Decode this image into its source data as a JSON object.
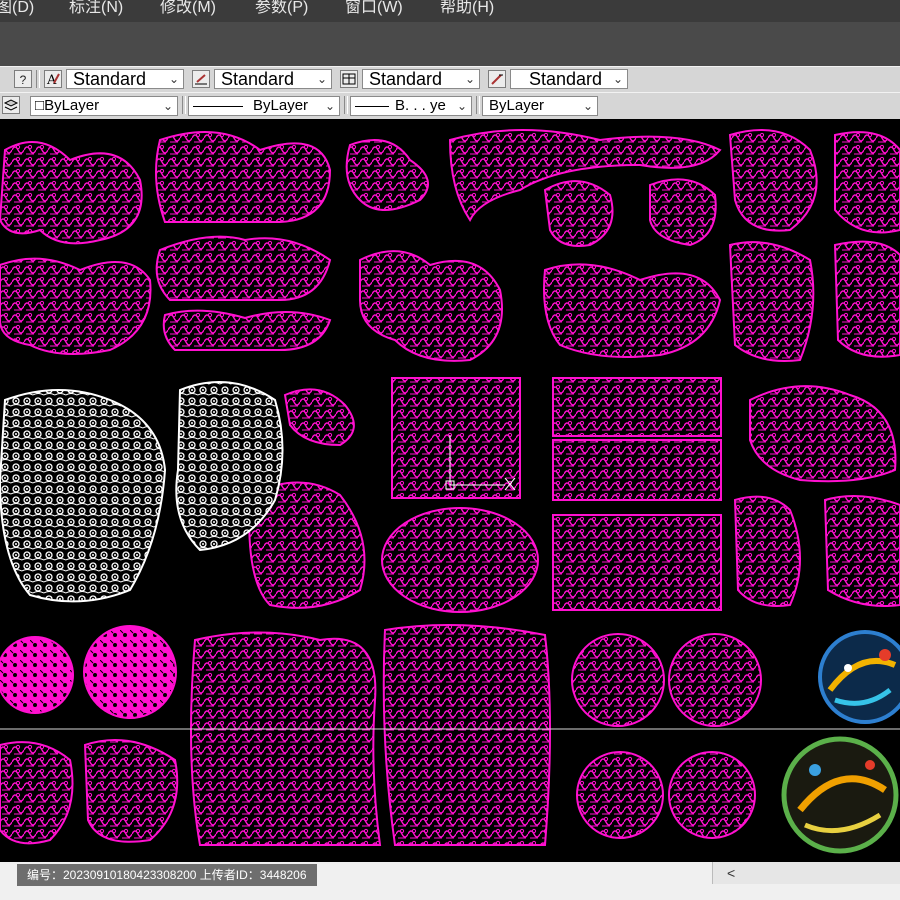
{
  "menubar": {
    "items": [
      "图(D)",
      "标注(N)",
      "修改(M)",
      "参数(P)",
      "窗口(W)",
      "帮助(H)"
    ]
  },
  "toolbar1": {
    "help_icon": "?",
    "text_style": "Standard",
    "dim_style": "Standard",
    "table_style": "Standard",
    "mleader_style": "Standard"
  },
  "toolbar2": {
    "color": "ByLayer",
    "linetype": "ByLayer",
    "lineweight": "B. . . ye",
    "plotstyle": "ByLayer"
  },
  "status": {
    "watermark_text": "编号：20230910180423308200  上传者ID：3448206",
    "scroll_left": "<"
  },
  "colors": {
    "drawing": "#ff10cf",
    "white_drawing": "#ffffff",
    "background": "#000000"
  },
  "icons": [
    "text-style-icon",
    "dim-style-icon",
    "table-style-icon",
    "mleader-style-icon",
    "layer-icon",
    "crosshair-icon"
  ]
}
